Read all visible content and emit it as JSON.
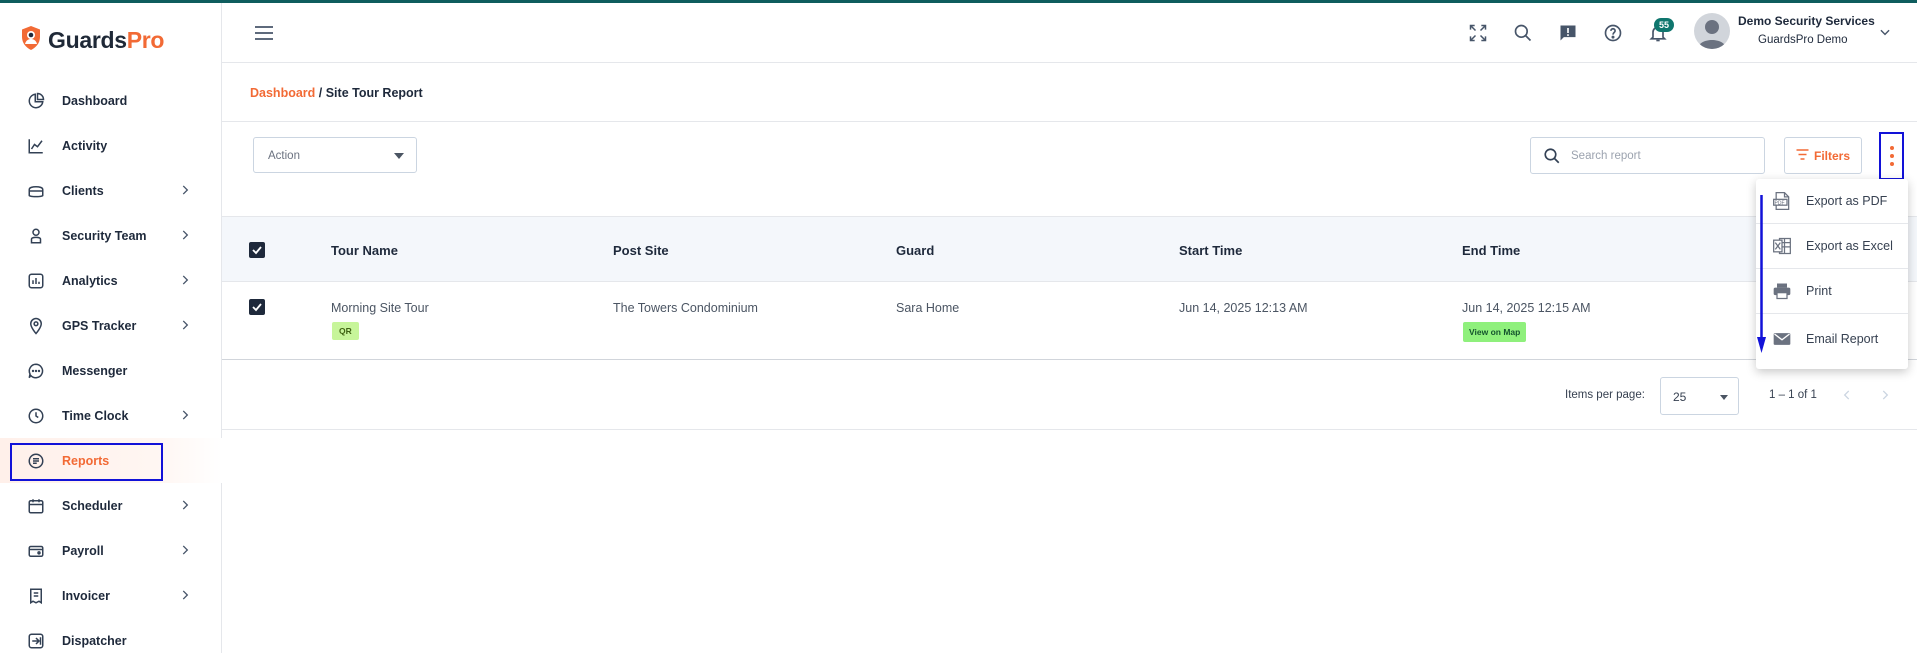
{
  "brand": {
    "logo_part1": "Guards",
    "logo_part2": "Pro"
  },
  "sidebar": {
    "items": [
      {
        "label": "Dashboard",
        "icon": "dashboard-icon",
        "has_children": false
      },
      {
        "label": "Activity",
        "icon": "activity-icon",
        "has_children": false
      },
      {
        "label": "Clients",
        "icon": "clients-icon",
        "has_children": true
      },
      {
        "label": "Security Team",
        "icon": "security-team-icon",
        "has_children": true
      },
      {
        "label": "Analytics",
        "icon": "analytics-icon",
        "has_children": true
      },
      {
        "label": "GPS Tracker",
        "icon": "gps-tracker-icon",
        "has_children": true
      },
      {
        "label": "Messenger",
        "icon": "messenger-icon",
        "has_children": false
      },
      {
        "label": "Time Clock",
        "icon": "time-clock-icon",
        "has_children": true
      },
      {
        "label": "Reports",
        "icon": "reports-icon",
        "has_children": false,
        "active": true
      },
      {
        "label": "Scheduler",
        "icon": "scheduler-icon",
        "has_children": true
      },
      {
        "label": "Payroll",
        "icon": "payroll-icon",
        "has_children": true
      },
      {
        "label": "Invoicer",
        "icon": "invoicer-icon",
        "has_children": true
      },
      {
        "label": "Dispatcher",
        "icon": "dispatcher-icon",
        "has_children": false
      }
    ]
  },
  "header": {
    "notification_count": "55",
    "user_name": "Demo Security Services",
    "user_org": "GuardsPro Demo"
  },
  "breadcrumb": {
    "home": "Dashboard",
    "separator": " / ",
    "current": "Site Tour Report"
  },
  "toolbar": {
    "action_placeholder": "Action",
    "search_placeholder": "Search report",
    "filters_label": "Filters"
  },
  "table": {
    "columns": [
      "Tour Name",
      "Post Site",
      "Guard",
      "Start Time",
      "End Time"
    ],
    "rows": [
      {
        "tour_name": "Morning Site Tour",
        "tour_tag": "QR",
        "post_site": "The Towers Condominium",
        "guard": "Sara Home",
        "start_time": "Jun 14, 2025 12:13 AM",
        "end_time": "Jun 14, 2025 12:15 AM",
        "map_link": "View on Map"
      }
    ]
  },
  "pagination": {
    "items_per_page_label": "Items per page:",
    "items_per_page": "25",
    "range": "1 – 1 of 1"
  },
  "export_menu": {
    "items": [
      {
        "label": "Export as PDF",
        "icon": "pdf-icon"
      },
      {
        "label": "Export as Excel",
        "icon": "excel-icon"
      },
      {
        "label": "Print",
        "icon": "print-icon"
      },
      {
        "label": "Email Report",
        "icon": "email-icon"
      }
    ]
  },
  "colors": {
    "brand_orange": "#f26a35",
    "annotation_blue": "#1212d8",
    "dark_text": "#1e293b",
    "header_accent": "#0f5d5e"
  }
}
